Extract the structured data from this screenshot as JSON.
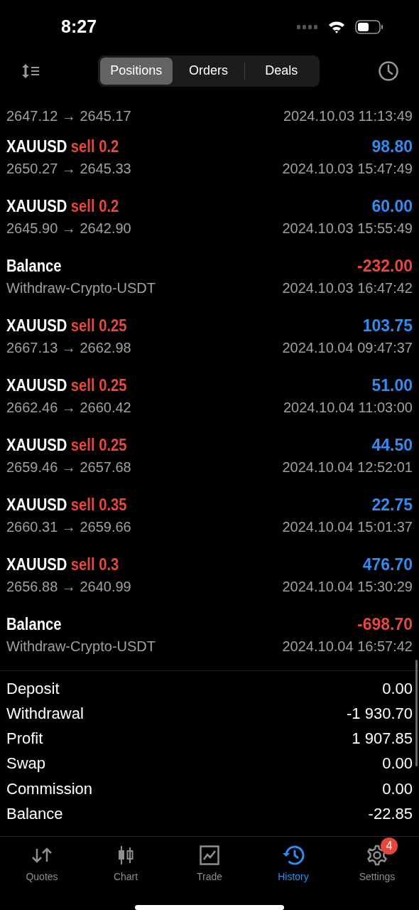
{
  "status_bar": {
    "time": "8:27"
  },
  "tabs": [
    {
      "label": "Positions",
      "selected": true
    },
    {
      "label": "Orders",
      "selected": false
    },
    {
      "label": "Deals",
      "selected": false
    }
  ],
  "rows": [
    {
      "kind": "partial",
      "prices": "2647.12 → 2645.17",
      "time": "2024.10.03 11:13:49"
    },
    {
      "kind": "trade",
      "symbol": "XAUUSD",
      "side": "sell 0.2",
      "profit": "98.80",
      "positive": true,
      "prices": "2650.27 → 2645.33",
      "time": "2024.10.03 15:47:49"
    },
    {
      "kind": "trade",
      "symbol": "XAUUSD",
      "side": "sell 0.2",
      "profit": "60.00",
      "positive": true,
      "prices": "2645.90 → 2642.90",
      "time": "2024.10.03 15:55:49"
    },
    {
      "kind": "balance",
      "symbol": "Balance",
      "profit": "-232.00",
      "positive": false,
      "prices": "Withdraw-Crypto-USDT",
      "time": "2024.10.03 16:47:42"
    },
    {
      "kind": "trade",
      "symbol": "XAUUSD",
      "side": "sell 0.25",
      "profit": "103.75",
      "positive": true,
      "prices": "2667.13 → 2662.98",
      "time": "2024.10.04 09:47:37"
    },
    {
      "kind": "trade",
      "symbol": "XAUUSD",
      "side": "sell 0.25",
      "profit": "51.00",
      "positive": true,
      "prices": "2662.46 → 2660.42",
      "time": "2024.10.04 11:03:00"
    },
    {
      "kind": "trade",
      "symbol": "XAUUSD",
      "side": "sell 0.25",
      "profit": "44.50",
      "positive": true,
      "prices": "2659.46 → 2657.68",
      "time": "2024.10.04 12:52:01"
    },
    {
      "kind": "trade",
      "symbol": "XAUUSD",
      "side": "sell 0.35",
      "profit": "22.75",
      "positive": true,
      "prices": "2660.31 → 2659.66",
      "time": "2024.10.04 15:01:37"
    },
    {
      "kind": "trade",
      "symbol": "XAUUSD",
      "side": "sell 0.3",
      "profit": "476.70",
      "positive": true,
      "prices": "2656.88 → 2640.99",
      "time": "2024.10.04 15:30:29"
    },
    {
      "kind": "balance",
      "symbol": "Balance",
      "profit": "-698.70",
      "positive": false,
      "prices": "Withdraw-Crypto-USDT",
      "time": "2024.10.04 16:57:42"
    }
  ],
  "summary": [
    {
      "label": "Deposit",
      "value": "0.00"
    },
    {
      "label": "Withdrawal",
      "value": "-1 930.70"
    },
    {
      "label": "Profit",
      "value": "1 907.85"
    },
    {
      "label": "Swap",
      "value": "0.00"
    },
    {
      "label": "Commission",
      "value": "0.00"
    },
    {
      "label": "Balance",
      "value": "-22.85"
    }
  ],
  "nav": [
    {
      "label": "Quotes",
      "kind": "quotes",
      "selected": false
    },
    {
      "label": "Chart",
      "kind": "chart",
      "selected": false
    },
    {
      "label": "Trade",
      "kind": "trade",
      "selected": false
    },
    {
      "label": "History",
      "kind": "history",
      "selected": true
    },
    {
      "label": "Settings",
      "kind": "settings",
      "selected": false,
      "badge": "4"
    }
  ]
}
